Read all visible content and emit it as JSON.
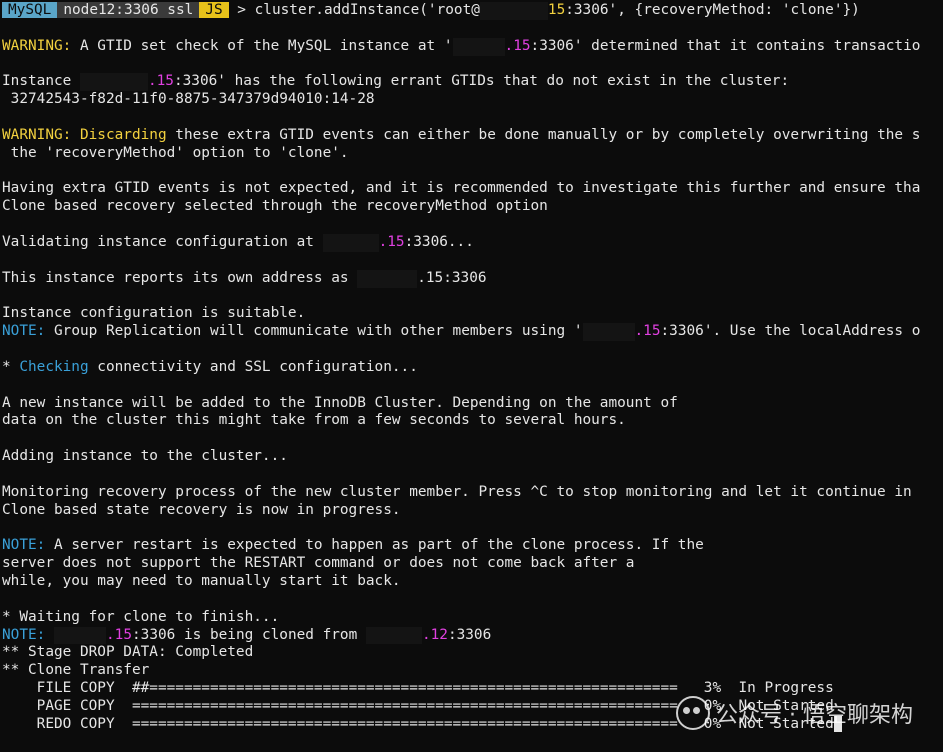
{
  "prompt": {
    "mysql": "MySQL",
    "host": "node12:3306 ssl",
    "mode": "JS",
    "arrow": ">",
    "cmd_a": " cluster.addInstance('root@",
    "cmd_b": "15",
    "cmd_c": ":3306', {recoveryMethod: 'clone'})"
  },
  "l2": {
    "warn": "WARNING:",
    "a": " A GTID set check of the MySQL instance at '",
    "b": ".15",
    "c": ":3306' determined that it contains transactio"
  },
  "l4": {
    "a": "Instance ",
    "b": ".15",
    "c": ":3306' has the following errant GTIDs that do not exist in the cluster:"
  },
  "l5": " 32742543-f82d-11f0-8875-347379d94010:14-28",
  "l7": {
    "warn": "WARNING: Discarding",
    "a": " these extra GTID events can either be done manually or by completely overwriting the s"
  },
  "l8": " the 'recoveryMethod' option to 'clone'.",
  "l10": "Having extra GTID events is not expected, and it is recommended to investigate this further and ensure tha",
  "l11": "Clone based recovery selected through the recoveryMethod option",
  "l13": {
    "a": "Validating instance configuration at ",
    "b": ".15",
    "c": ":3306..."
  },
  "l15": {
    "a": "This instance reports its own address as ",
    "b": ".15:3306"
  },
  "l17": "Instance configuration is suitable.",
  "l18": {
    "note": "NOTE:",
    "a": " Group Replication will communicate with other members using '",
    "b": ".15",
    "c": ":3306'. Use the localAddress o"
  },
  "l20": {
    "a": "* ",
    "b": "Checking",
    "c": " connectivity and SSL configuration..."
  },
  "l22": "A new instance will be added to the InnoDB Cluster. Depending on the amount of",
  "l23": "data on the cluster this might take from a few seconds to several hours.",
  "l25": "Adding instance to the cluster...",
  "l27": "Monitoring recovery process of the new cluster member. Press ^C to stop monitoring and let it continue in",
  "l28": "Clone based state recovery is now in progress.",
  "l30": {
    "note": "NOTE:",
    "a": " A server restart is expected to happen as part of the clone process. If the"
  },
  "l31": "server does not support the RESTART command or does not come back after a",
  "l32": "while, you may need to manually start it back.",
  "l34": "* Waiting for clone to finish...",
  "l35": {
    "note": "NOTE:",
    "b": ".15",
    "c": ":3306 is being cloned from ",
    "d": ".12",
    "e": ":3306"
  },
  "l36": "** Stage DROP DATA: Completed",
  "l37": "** Clone Transfer",
  "progress": [
    {
      "label": "    FILE COPY  ",
      "bar": "##=============================================================",
      "pct": "3%",
      "status": "In Progress"
    },
    {
      "label": "    PAGE COPY  ",
      "bar": "===============================================================",
      "pct": "0%",
      "status": "Not Started"
    },
    {
      "label": "    REDO COPY  ",
      "bar": "===============================================================",
      "pct": "0%",
      "status": "Not Started"
    }
  ],
  "watermark": "公众号 · 悟空聊架构"
}
